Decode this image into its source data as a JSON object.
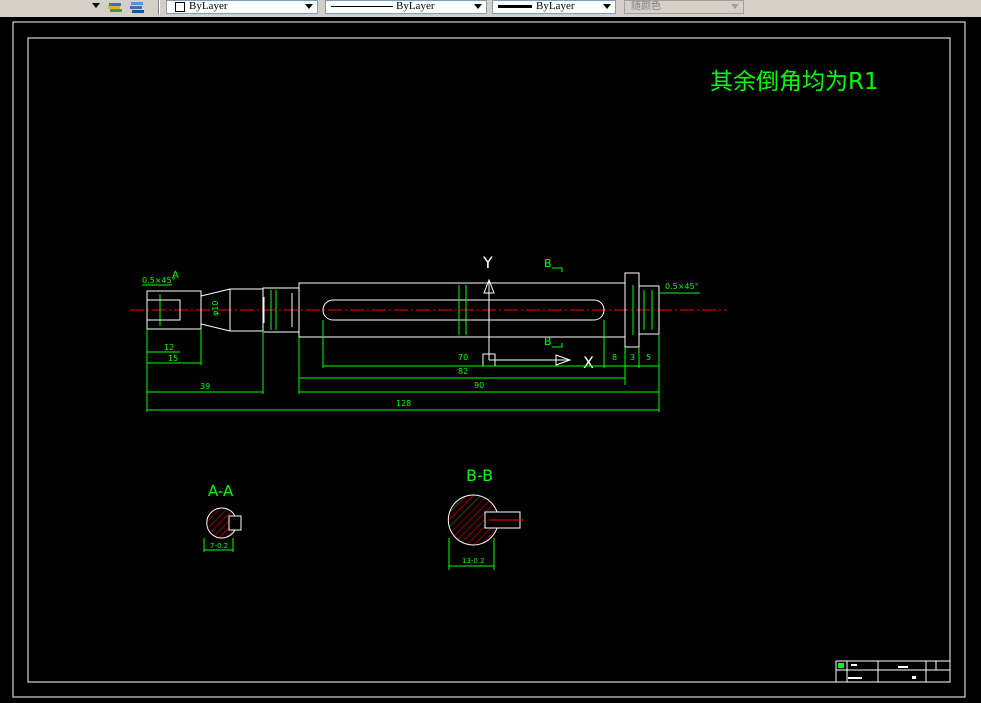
{
  "toolbar": {
    "color_combo": "ByLayer",
    "linetype_combo": "ByLayer",
    "lineweight_combo": "ByLayer",
    "plotstyle_combo": "随颜色"
  },
  "drawing": {
    "note": "其余倒角均为R1",
    "ucs": {
      "y_label": "Y",
      "x_label": "X"
    },
    "section_markers": {
      "a": "A",
      "b_top": "B",
      "b_bottom": "B"
    },
    "chamfer_left": "0.5×45°",
    "chamfer_right": "0.5×45°",
    "dims": {
      "d12": "12",
      "d15": "15",
      "d39": "39",
      "d70": "70",
      "d82": "82",
      "d90": "90",
      "d128": "128",
      "d8": "8",
      "d3": "3",
      "d5": "5",
      "phi10": "φ10"
    },
    "sections": {
      "aa_title": "A-A",
      "bb_title": "B-B",
      "aa_dim": "7-0.2",
      "bb_dim": "13-0.2"
    }
  },
  "colors": {
    "outline": "#ffffff",
    "dimension": "#00ff00",
    "centerline": "#ff0000",
    "hatch": "#ff0000"
  }
}
